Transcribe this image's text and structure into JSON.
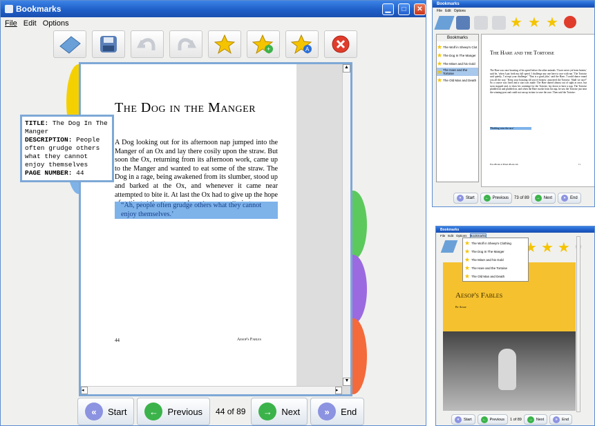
{
  "main": {
    "title": "Bookmarks",
    "menu": [
      "File",
      "Edit",
      "Options"
    ],
    "page": {
      "heading": "The Dog in the Manger",
      "paragraph": "A Dog looking out for its afternoon nap jumped into the Manger of an Ox and lay there cosily upon the straw. But soon the Ox, returning from its afternoon work, came up to the Manger and wanted to eat some of the straw. The Dog in a rage, being awakened from its slumber, stood up and barked at the Ox, and whenever it came near attempted to bite it. At last the Ox had to give up the hope of getting at the straw, and went away muttering:",
      "highlight": "“Ah, people often grudge others what they cannot enjoy themselves.’",
      "page_number": "44",
      "footer_title": "Aesop's Fables"
    },
    "tooltip": {
      "title_label": "TITLE:",
      "title_value": "The Dog In The Manger",
      "desc_label": "DESCRIPTION:",
      "desc_value": "People often grudge others what they cannot enjoy themselves",
      "page_label": "PAGE NUMBER:",
      "page_value": "44"
    },
    "nav": {
      "start": "Start",
      "previous": "Previous",
      "counter": "44 of 89",
      "next": "Next",
      "end": "End"
    },
    "tab_colors": [
      "#f5d000",
      "#7fb3e8",
      "#5cc95c",
      "#9b6ae0",
      "#f46a3a"
    ]
  },
  "top_right": {
    "title": "Bookmarks",
    "menu": [
      "File",
      "Edit",
      "Options"
    ],
    "sidebar_header": "Bookmarks",
    "bookmarks": [
      "The Wolf in Sheep's Clot",
      "The Dog In The Manger",
      "The Miser and his Gold",
      "The Hare and the Tortoise",
      "The Old Man and Death"
    ],
    "page_heading": "The Hare and the Tortoise",
    "page_text": "The Hare was once boasting of his speed before the other animals. 'I have never yet been beaten,' said he, 'when I put forth my full speed. I challenge any one here to race with me.' The Tortoise said quietly, 'I accept your challenge.' 'That is a good joke,' said the Hare; 'I could dance round you all the way.' 'Keep your boasting till you've beaten,' answered the Tortoise. 'Shall we race?' So a course was fixed and a start was made. The Hare darted almost out of sight at once, but soon stopped and, to show his contempt for the Tortoise, lay down to have a nap. The Tortoise plodded on and plodded on, and when the Hare awoke from his nap, he saw the Tortoise just near the winning-post and could not run up in time to save the race. Then said the Tortoise:",
    "page_highlight": "'Plodding wins the race.'",
    "page_footer_left": "Free eBooks at Planet eBook.com",
    "page_footer_right": "11",
    "nav": {
      "start": "Start",
      "previous": "Previous",
      "counter": "73 of 89",
      "next": "Next",
      "end": "End"
    }
  },
  "bottom_right": {
    "title": "Bookmarks",
    "menu": [
      "File",
      "Edit",
      "Options",
      "Bookmarks"
    ],
    "dropdown": [
      "The Wolf in Sheep's Clothing",
      "The Dog In The Manger",
      "The Miser and his Gold",
      "The Hare and the Tortoise",
      "The Old Man and Death"
    ],
    "cover_title": "Aesop's Fables",
    "cover_author": "By Aesop",
    "nav": {
      "start": "Start",
      "previous": "Previous",
      "counter": "1 of 89",
      "next": "Next",
      "end": "End"
    }
  }
}
